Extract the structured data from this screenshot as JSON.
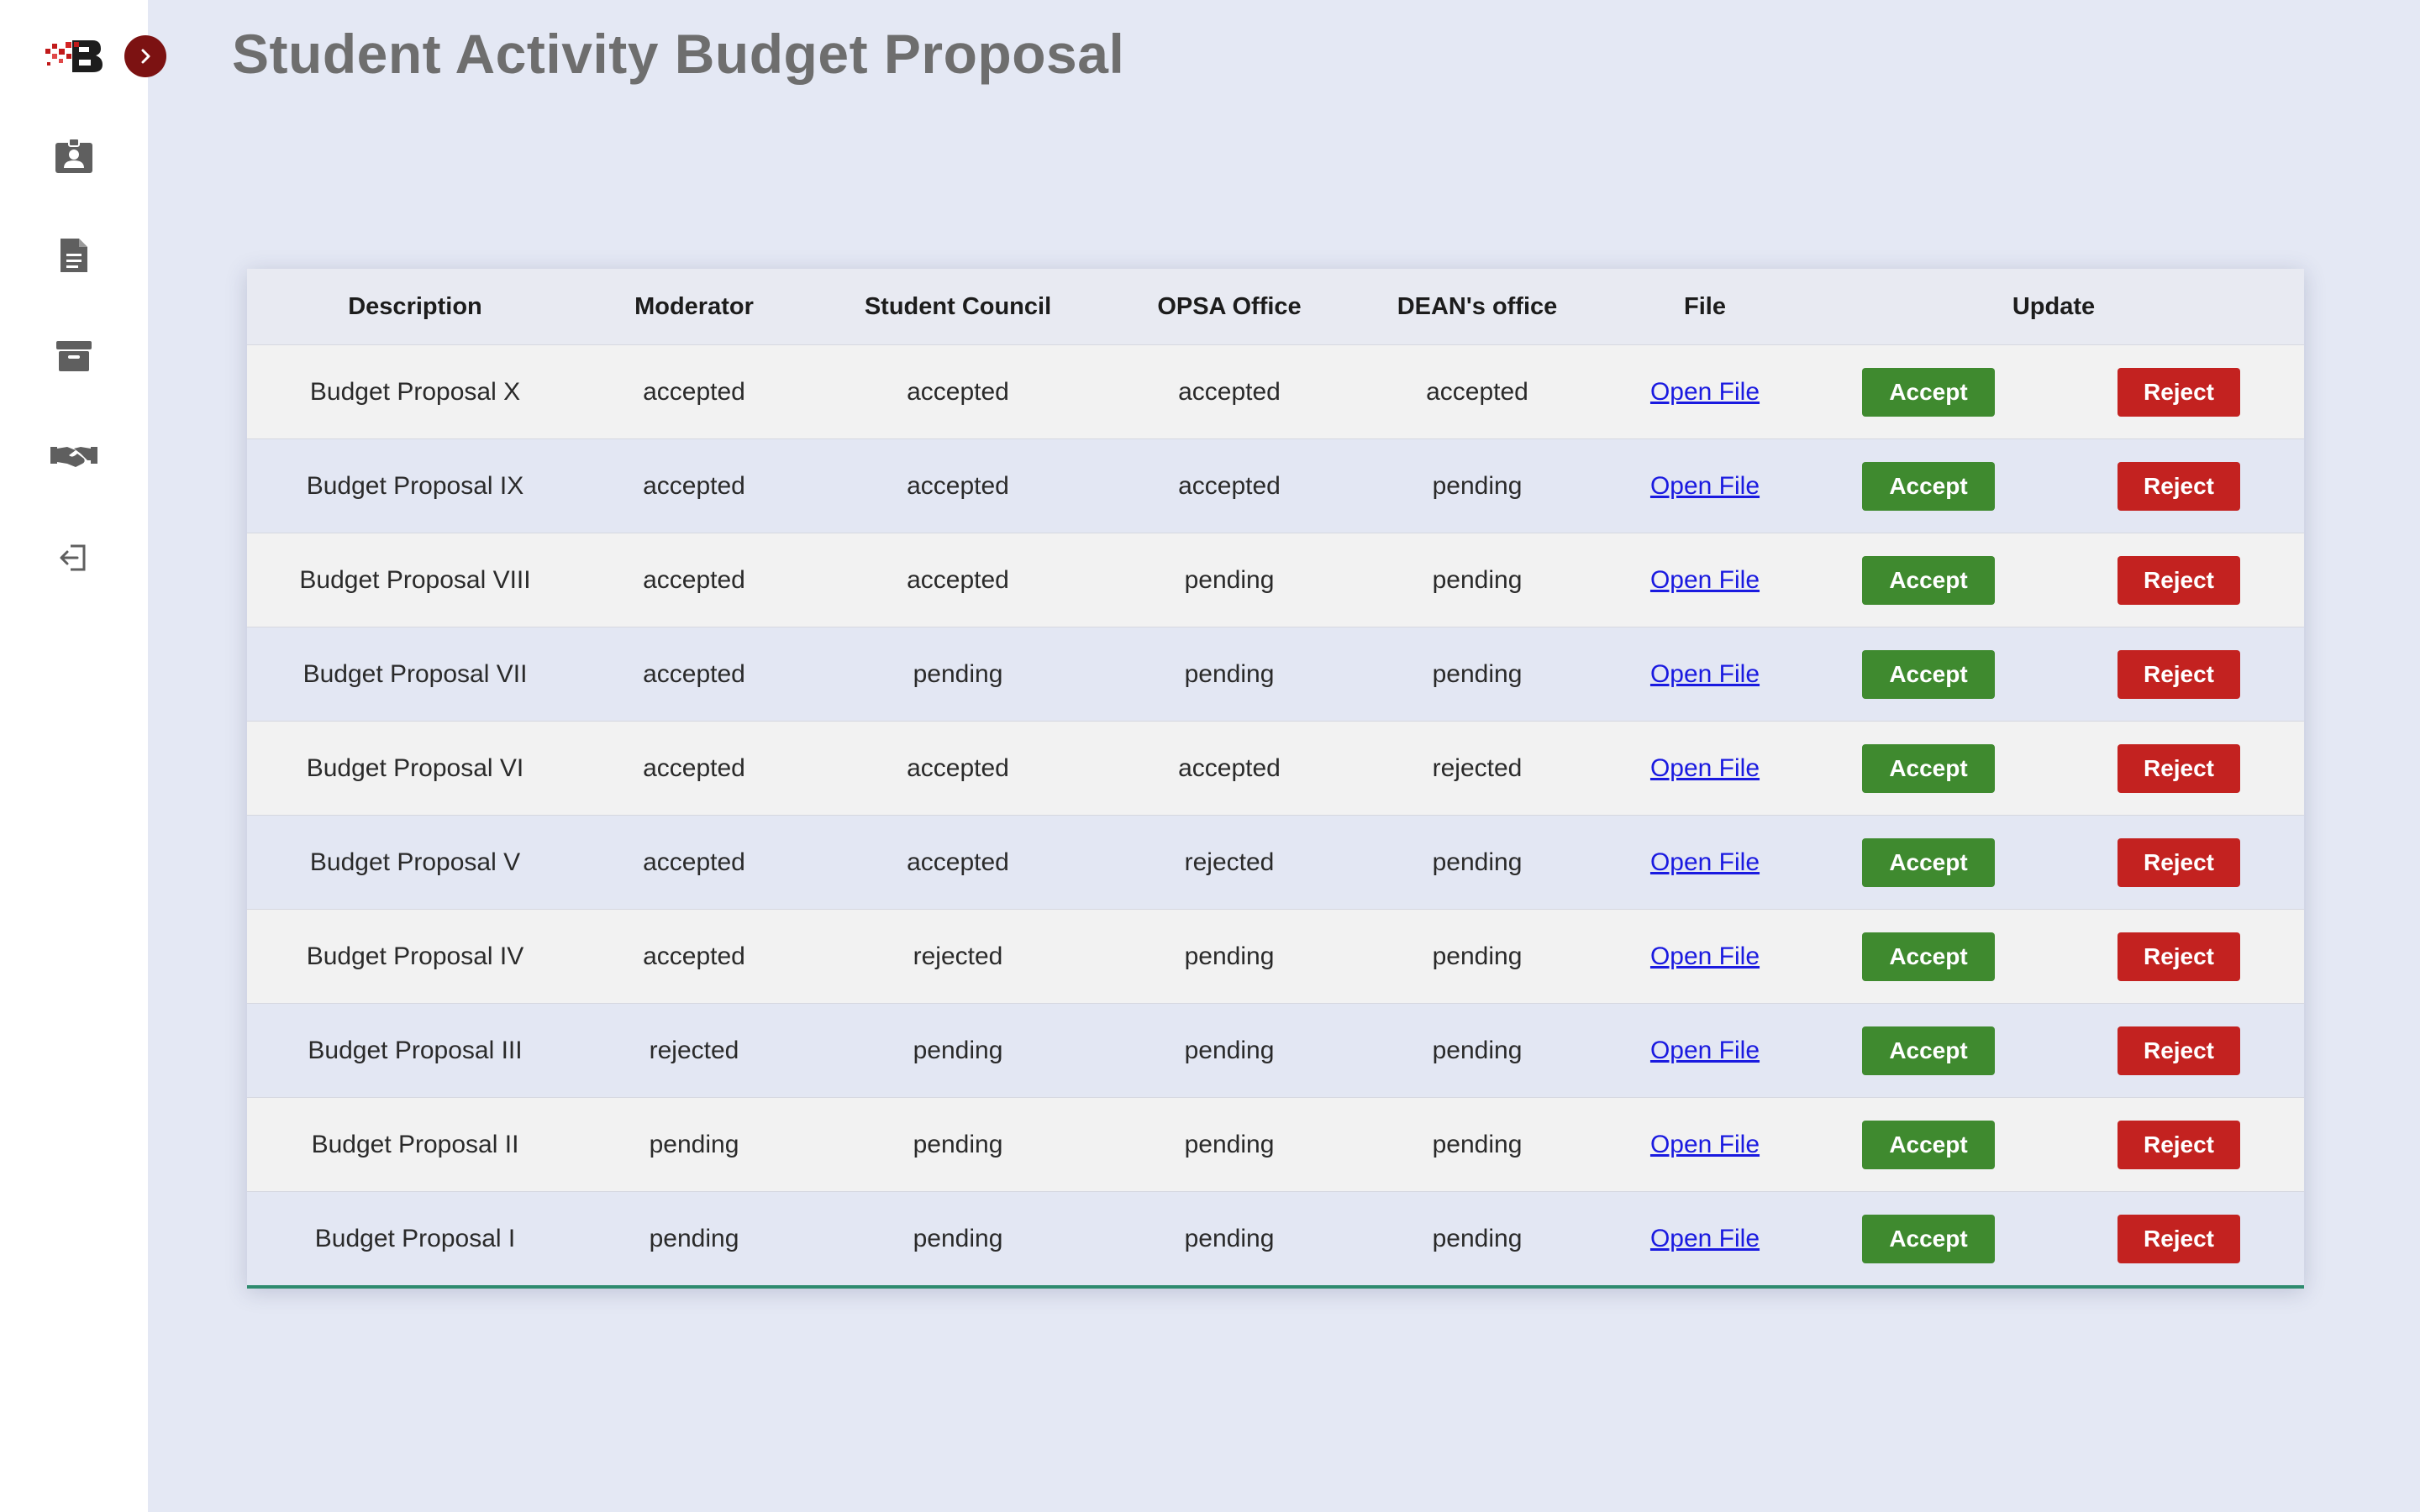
{
  "page": {
    "title": "Student Activity Budget Proposal"
  },
  "sidebar": {
    "items": [
      {
        "icon": "id-badge-icon"
      },
      {
        "icon": "document-icon"
      },
      {
        "icon": "archive-icon"
      },
      {
        "icon": "handshake-icon"
      },
      {
        "icon": "sign-out-icon"
      }
    ]
  },
  "colors": {
    "accept": "#3f8a2f",
    "reject": "#c32220",
    "brand": "#7c1212",
    "link": "#1a1ae0",
    "table_border_accent": "#2e8b6e"
  },
  "table": {
    "headers": [
      "Description",
      "Moderator",
      "Student Council",
      "OPSA Office",
      "DEAN's office",
      "File",
      "Update"
    ],
    "rows": [
      {
        "description": "Budget Proposal X",
        "moderator": "accepted",
        "council": "accepted",
        "opsa": "accepted",
        "dean": "accepted",
        "file": "Open File",
        "accept": "Accept",
        "reject": "Reject"
      },
      {
        "description": "Budget Proposal IX",
        "moderator": "accepted",
        "council": "accepted",
        "opsa": "accepted",
        "dean": "pending",
        "file": "Open File",
        "accept": "Accept",
        "reject": "Reject"
      },
      {
        "description": "Budget Proposal VIII",
        "moderator": "accepted",
        "council": "accepted",
        "opsa": "pending",
        "dean": "pending",
        "file": "Open File",
        "accept": "Accept",
        "reject": "Reject"
      },
      {
        "description": "Budget Proposal VII",
        "moderator": "accepted",
        "council": "pending",
        "opsa": "pending",
        "dean": "pending",
        "file": "Open File",
        "accept": "Accept",
        "reject": "Reject"
      },
      {
        "description": "Budget Proposal VI",
        "moderator": "accepted",
        "council": "accepted",
        "opsa": "accepted",
        "dean": "rejected",
        "file": "Open File",
        "accept": "Accept",
        "reject": "Reject"
      },
      {
        "description": "Budget Proposal V",
        "moderator": "accepted",
        "council": "accepted",
        "opsa": "rejected",
        "dean": "pending",
        "file": "Open File",
        "accept": "Accept",
        "reject": "Reject"
      },
      {
        "description": "Budget Proposal IV",
        "moderator": "accepted",
        "council": "rejected",
        "opsa": "pending",
        "dean": "pending",
        "file": "Open File",
        "accept": "Accept",
        "reject": "Reject"
      },
      {
        "description": "Budget Proposal III",
        "moderator": "rejected",
        "council": "pending",
        "opsa": "pending",
        "dean": "pending",
        "file": "Open File",
        "accept": "Accept",
        "reject": "Reject"
      },
      {
        "description": "Budget Proposal II",
        "moderator": "pending",
        "council": "pending",
        "opsa": "pending",
        "dean": "pending",
        "file": "Open File",
        "accept": "Accept",
        "reject": "Reject"
      },
      {
        "description": "Budget Proposal I",
        "moderator": "pending",
        "council": "pending",
        "opsa": "pending",
        "dean": "pending",
        "file": "Open File",
        "accept": "Accept",
        "reject": "Reject"
      }
    ]
  }
}
